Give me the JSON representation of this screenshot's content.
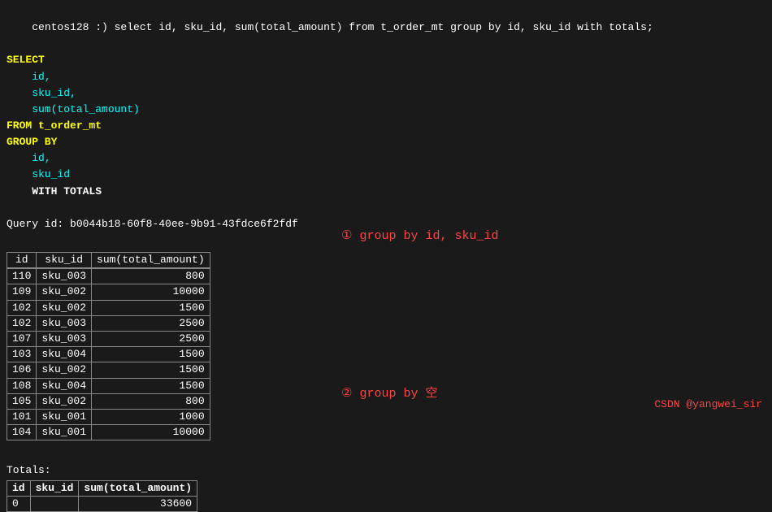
{
  "terminal": {
    "prompt_line": "centos128 :) select id, sku_id, sum(total_amount) from t_order_mt group by id, sku_id with totals;",
    "sql_lines": [
      {
        "text": "SELECT",
        "color": "yellow"
      },
      {
        "text": "    id,",
        "color": "cyan"
      },
      {
        "text": "    sku_id,",
        "color": "cyan"
      },
      {
        "text": "    sum(total_amount)",
        "color": "cyan"
      },
      {
        "text": "FROM t_order_mt",
        "color": "yellow"
      },
      {
        "text": "GROUP BY",
        "color": "yellow"
      },
      {
        "text": "    id,",
        "color": "cyan"
      },
      {
        "text": "    sku_id",
        "color": "cyan"
      },
      {
        "text": "    WITH TOTALS",
        "color": "white bold"
      }
    ],
    "query_id_line": "Query id: b0044b18-60f8-40ee-9b91-43fdce6f2fdf",
    "table_headers": [
      "id",
      "sku_id",
      "sum(total_amount)"
    ],
    "table_rows": [
      [
        "110",
        "sku_003",
        "800"
      ],
      [
        "109",
        "sku_002",
        "10000"
      ],
      [
        "102",
        "sku_002",
        "1500"
      ],
      [
        "102",
        "sku_003",
        "2500"
      ],
      [
        "107",
        "sku_003",
        "2500"
      ],
      [
        "103",
        "sku_004",
        "1500"
      ],
      [
        "106",
        "sku_002",
        "1500"
      ],
      [
        "108",
        "sku_004",
        "1500"
      ],
      [
        "105",
        "sku_002",
        "800"
      ],
      [
        "101",
        "sku_001",
        "1000"
      ],
      [
        "104",
        "sku_001",
        "10000"
      ]
    ],
    "totals_label": "Totals:",
    "totals_headers": [
      "id",
      "sku_id",
      "sum(total_amount)"
    ],
    "totals_rows": [
      [
        "0",
        "",
        "33600"
      ]
    ],
    "annotation_1": "① group by id, sku_id",
    "annotation_2": "② group by 空",
    "csdn_credit": "CSDN @yangwei_sir"
  }
}
